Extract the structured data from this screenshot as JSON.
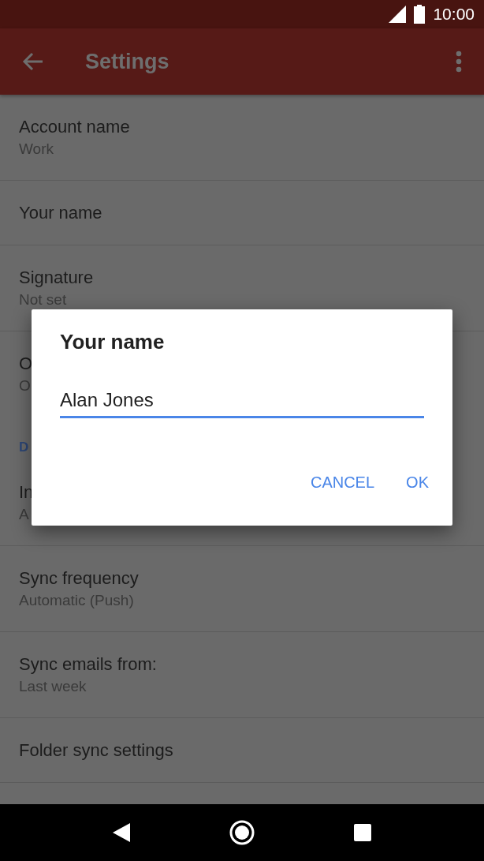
{
  "status_bar": {
    "time": "10:00"
  },
  "app_bar": {
    "title": "Settings"
  },
  "settings": [
    {
      "kind": "item",
      "title": "Account name",
      "summary": "Work"
    },
    {
      "kind": "item",
      "title": "Your name"
    },
    {
      "kind": "item",
      "title": "Signature",
      "summary": "Not set"
    },
    {
      "kind": "item",
      "title": "O",
      "summary": "O"
    },
    {
      "kind": "header",
      "title": "D"
    },
    {
      "kind": "item",
      "title": "In",
      "summary": "A"
    },
    {
      "kind": "item",
      "title": "Sync frequency",
      "summary": "Automatic (Push)"
    },
    {
      "kind": "item",
      "title": "Sync emails from:",
      "summary": "Last week"
    },
    {
      "kind": "item",
      "title": "Folder sync settings"
    }
  ],
  "dialog": {
    "title": "Your name",
    "value": "Alan Jones",
    "buttons": [
      "CANCEL",
      "OK"
    ]
  }
}
